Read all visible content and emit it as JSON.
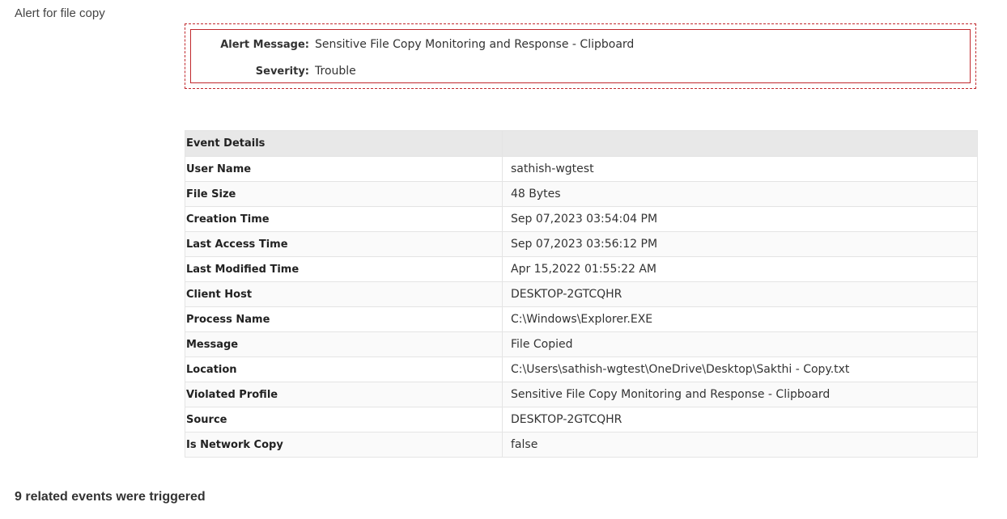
{
  "page": {
    "title": "Alert for file copy",
    "related_events": "9 related events were triggered"
  },
  "alert": {
    "message_label": "Alert Message:",
    "message_value": "Sensitive File Copy Monitoring and Response - Clipboard",
    "severity_label": "Severity:",
    "severity_value": "Trouble",
    "border_color": "#c0282d"
  },
  "details": {
    "header": "Event Details",
    "rows": [
      {
        "key": "User Name",
        "value": "sathish-wgtest"
      },
      {
        "key": "File Size",
        "value": "48 Bytes"
      },
      {
        "key": "Creation Time",
        "value": "Sep 07,2023 03:54:04 PM"
      },
      {
        "key": "Last Access Time",
        "value": "Sep 07,2023 03:56:12 PM"
      },
      {
        "key": "Last Modified Time",
        "value": "Apr 15,2022 01:55:22 AM"
      },
      {
        "key": "Client Host",
        "value": "DESKTOP-2GTCQHR"
      },
      {
        "key": "Process Name",
        "value": "C:\\Windows\\Explorer.EXE"
      },
      {
        "key": "Message",
        "value": "File Copied"
      },
      {
        "key": "Location",
        "value": "C:\\Users\\sathish-wgtest\\OneDrive\\Desktop\\Sakthi - Copy.txt"
      },
      {
        "key": "Violated Profile",
        "value": "Sensitive File Copy Monitoring and Response - Clipboard"
      },
      {
        "key": "Source",
        "value": "DESKTOP-2GTCQHR"
      },
      {
        "key": "Is Network Copy",
        "value": "false"
      }
    ]
  }
}
